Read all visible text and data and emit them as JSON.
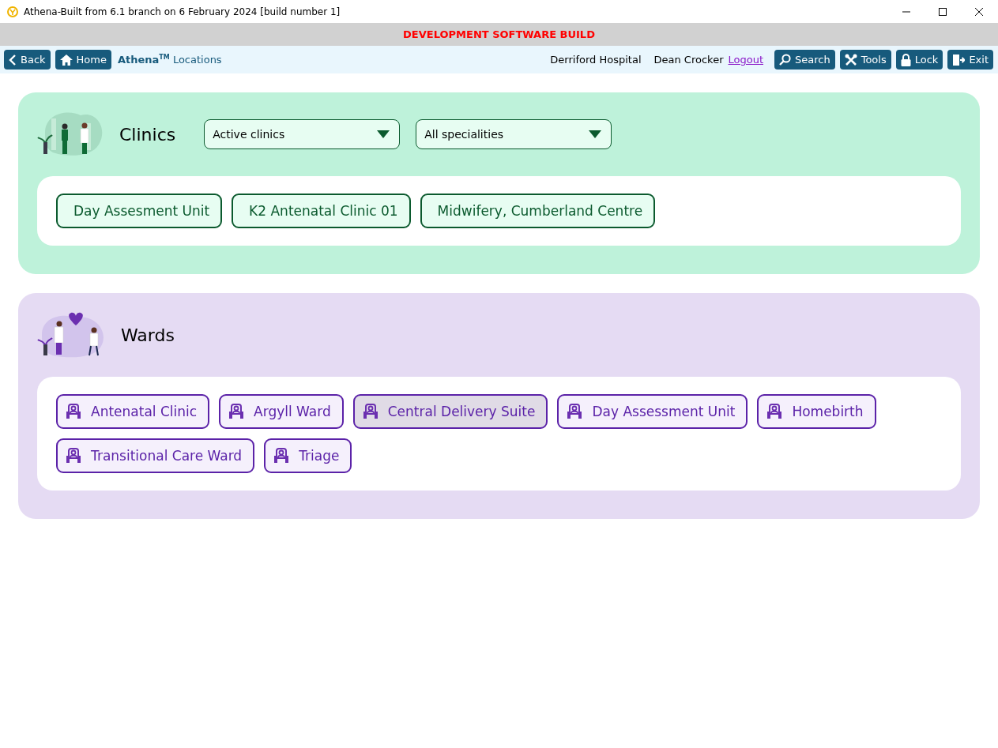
{
  "window": {
    "title": "Athena-Built from 6.1 branch on 6 February 2024 [build number 1]"
  },
  "banner": "DEVELOPMENT SOFTWARE BUILD",
  "nav": {
    "back": "Back",
    "home": "Home",
    "breadcrumb": "**Athena**$^{TM}$ Locations",
    "hospital": "Derriford Hospital",
    "user": "Dean Crocker",
    "logout": "Logout",
    "actions": [
      {
        "kind": "search",
        "label": "Search"
      },
      {
        "kind": "tools",
        "label": "Tools"
      },
      {
        "kind": "lock",
        "label": "Lock"
      },
      {
        "kind": "exit",
        "label": "Exit"
      }
    ]
  },
  "clinics": {
    "title": "Clinics",
    "filters": [
      {
        "value": "Active clinics"
      },
      {
        "value": "All specialities"
      }
    ],
    "items": [
      {
        "label": "Day Assesment Unit"
      },
      {
        "label": "K2 Antenatal Clinic 01"
      },
      {
        "label": "Midwifery, Cumberland Centre"
      }
    ]
  },
  "wards": {
    "title": "Wards",
    "items": [
      {
        "label": "Antenatal Clinic",
        "selected": false
      },
      {
        "label": "Argyll Ward",
        "selected": false
      },
      {
        "label": "Central Delivery Suite",
        "selected": true
      },
      {
        "label": "Day Assessment Unit",
        "selected": false
      },
      {
        "label": "Homebirth",
        "selected": false
      },
      {
        "label": "Transitional Care Ward",
        "selected": false
      },
      {
        "label": "Triage",
        "selected": false
      }
    ]
  }
}
